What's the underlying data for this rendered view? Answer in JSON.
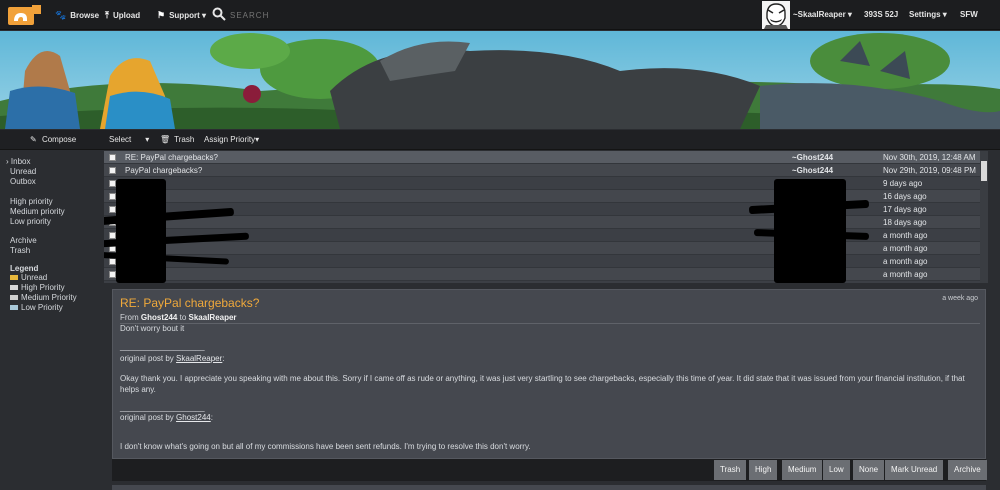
{
  "topbar": {
    "browse": "Browse",
    "upload": "Upload",
    "support": "Support",
    "search_placeholder": "SEARCH",
    "username": "~SkaalReaper",
    "stats": "393S 52J",
    "settings": "Settings",
    "sfw": "SFW"
  },
  "toolbar": {
    "compose": "Compose",
    "select": "Select",
    "trash": "Trash",
    "assign_priority": "Assign Priority"
  },
  "sidebar": {
    "inbox": "Inbox",
    "unread": "Unread",
    "outbox": "Outbox",
    "high": "High priority",
    "medium": "Medium priority",
    "low": "Low priority",
    "archive": "Archive",
    "trash": "Trash",
    "legend_title": "Legend",
    "legend": [
      {
        "label": "Unread",
        "color": "#e8b83c"
      },
      {
        "label": "High Priority",
        "color": "#d9d9d9"
      },
      {
        "label": "Medium Priority",
        "color": "#cfcfcf"
      },
      {
        "label": "Low Priority",
        "color": "#a8c8d8"
      }
    ]
  },
  "messages": [
    {
      "subject": "RE: PayPal chargebacks?",
      "from": "~Ghost244",
      "date": "Nov 30th, 2019, 12:48 AM"
    },
    {
      "subject": "PayPal chargebacks?",
      "from": "~Ghost244",
      "date": "Nov 29th, 2019, 09:48 PM"
    },
    {
      "subject": "",
      "from": "",
      "date": "9 days ago"
    },
    {
      "subject": "",
      "from": "",
      "date": "16 days ago"
    },
    {
      "subject": "",
      "from": "",
      "date": "17 days ago"
    },
    {
      "subject": "",
      "from": "",
      "date": "18 days ago"
    },
    {
      "subject": "",
      "from": "",
      "date": "a month ago"
    },
    {
      "subject": "",
      "from": "",
      "date": "a month ago"
    },
    {
      "subject": "",
      "from": "",
      "date": "a month ago"
    },
    {
      "subject": "",
      "from": "",
      "date": "a month ago"
    }
  ],
  "message_view": {
    "title": "RE: PayPal chargebacks?",
    "age": "a week ago",
    "from_word": "From",
    "sender": "Ghost244",
    "to_word": "to",
    "recipient": "SkaalReaper",
    "body_line": "Don't worry bout it",
    "divider": "___________________",
    "orig1_prefix": "original post by",
    "orig1_author": "SkaalReaper",
    "orig1_colon": ":",
    "orig1_text": "Okay thank you. I appreciate you speaking with me about this. Sorry if I came off as rude or anything, it was just very startling to see chargebacks, especially this time of year. It did state that it was issued from your financial institution, if that helps any.",
    "divider2": "___________________",
    "orig2_prefix": "original post by",
    "orig2_author": "Ghost244",
    "orig2_colon": ":",
    "orig2_text": "I don't know what's going on but all of my commissions have been sent refunds. I'm trying to resolve this don't worry."
  },
  "actions": [
    "Trash",
    "High",
    "Medium",
    "Low",
    "None",
    "Mark Unread",
    "Archive"
  ]
}
